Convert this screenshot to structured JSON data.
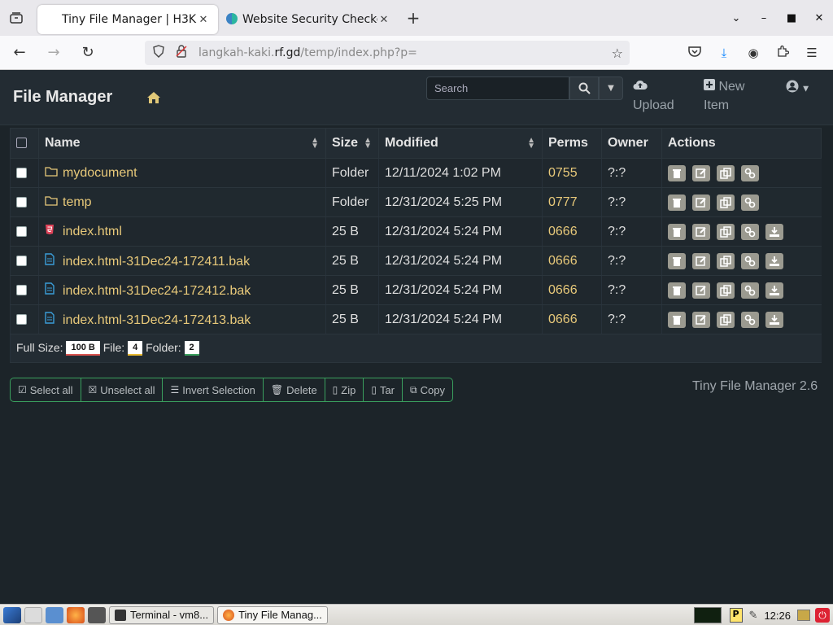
{
  "browser": {
    "tabs": [
      {
        "title": "Tiny File Manager | H3K",
        "active": true
      },
      {
        "title": "Website Security Checker",
        "active": false
      }
    ],
    "url_prefix": "langkah-kaki.",
    "url_domain": "rf.gd",
    "url_path": "/temp/index.php?p="
  },
  "header": {
    "title": "File Manager",
    "search_placeholder": "Search",
    "upload_label": "Upload",
    "new_label_1": "New",
    "new_label_2": "Item"
  },
  "table": {
    "columns": {
      "name": "Name",
      "size": "Size",
      "modified": "Modified",
      "perms": "Perms",
      "owner": "Owner",
      "actions": "Actions"
    },
    "rows": [
      {
        "type": "folder",
        "name": "mydocument",
        "size": "Folder",
        "modified": "12/11/2024 1:02 PM",
        "perms": "0755",
        "owner": "?:?"
      },
      {
        "type": "folder",
        "name": "temp",
        "size": "Folder",
        "modified": "12/31/2024 5:25 PM",
        "perms": "0777",
        "owner": "?:?"
      },
      {
        "type": "html",
        "name": "index.html",
        "size": "25 B",
        "modified": "12/31/2024 5:24 PM",
        "perms": "0666",
        "owner": "?:?"
      },
      {
        "type": "file",
        "name": "index.html-31Dec24-172411.bak",
        "size": "25 B",
        "modified": "12/31/2024 5:24 PM",
        "perms": "0666",
        "owner": "?:?"
      },
      {
        "type": "file",
        "name": "index.html-31Dec24-172412.bak",
        "size": "25 B",
        "modified": "12/31/2024 5:24 PM",
        "perms": "0666",
        "owner": "?:?"
      },
      {
        "type": "file",
        "name": "index.html-31Dec24-172413.bak",
        "size": "25 B",
        "modified": "12/31/2024 5:24 PM",
        "perms": "0666",
        "owner": "?:?"
      }
    ],
    "footer": {
      "full_size_label": "Full Size:",
      "full_size_value": "100 B",
      "file_label": "File:",
      "file_value": "4",
      "folder_label": "Folder:",
      "folder_value": "2"
    }
  },
  "bulk_actions": {
    "select_all": "Select all",
    "unselect_all": "Unselect all",
    "invert": "Invert Selection",
    "delete": "Delete",
    "zip": "Zip",
    "tar": "Tar",
    "copy": "Copy"
  },
  "version": "Tiny File Manager 2.6",
  "taskbar": {
    "tasks": [
      "Terminal - vm8...",
      "Tiny File Manag..."
    ],
    "clock": "12:26"
  },
  "colors": {
    "accent_gold": "#e8c97a",
    "html_icon": "#e0445a",
    "file_icon": "#3a9dd8",
    "group_border": "#3aa05e"
  }
}
